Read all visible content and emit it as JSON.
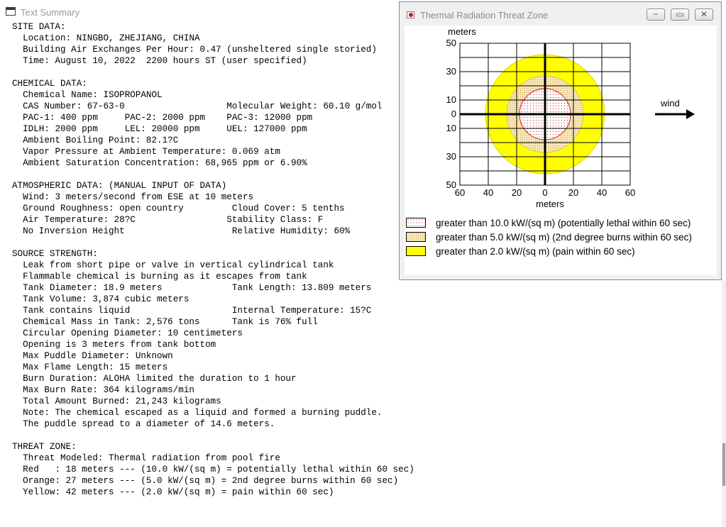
{
  "text_summary": {
    "title": "Text Summary",
    "lines": [
      "SITE DATA:",
      "  Location: NINGBO, ZHEJIANG, CHINA",
      "  Building Air Exchanges Per Hour: 0.47 (unsheltered single storied)",
      "  Time: August 10, 2022  2200 hours ST (user specified)",
      "",
      "CHEMICAL DATA:",
      "  Chemical Name: ISOPROPANOL",
      "  CAS Number: 67-63-0                   Molecular Weight: 60.10 g/mol",
      "  PAC-1: 400 ppm     PAC-2: 2000 ppm    PAC-3: 12000 ppm",
      "  IDLH: 2000 ppm     LEL: 20000 ppm     UEL: 127000 ppm",
      "  Ambient Boiling Point: 82.1?C",
      "  Vapor Pressure at Ambient Temperature: 0.069 atm",
      "  Ambient Saturation Concentration: 68,965 ppm or 6.90%",
      "",
      "ATMOSPHERIC DATA: (MANUAL INPUT OF DATA)",
      "  Wind: 3 meters/second from ESE at 10 meters",
      "  Ground Roughness: open country         Cloud Cover: 5 tenths",
      "  Air Temperature: 28?C                 Stability Class: F",
      "  No Inversion Height                    Relative Humidity: 60%",
      "",
      "SOURCE STRENGTH:",
      "  Leak from short pipe or valve in vertical cylindrical tank",
      "  Flammable chemical is burning as it escapes from tank",
      "  Tank Diameter: 18.9 meters             Tank Length: 13.809 meters",
      "  Tank Volume: 3,874 cubic meters",
      "  Tank contains liquid                   Internal Temperature: 15?C",
      "  Chemical Mass in Tank: 2,576 tons      Tank is 76% full",
      "  Circular Opening Diameter: 10 centimeters",
      "  Opening is 3 meters from tank bottom",
      "  Max Puddle Diameter: Unknown",
      "  Max Flame Length: 15 meters",
      "  Burn Duration: ALOHA limited the duration to 1 hour",
      "  Max Burn Rate: 364 kilograms/min",
      "  Total Amount Burned: 21,243 kilograms",
      "  Note: The chemical escaped as a liquid and formed a burning puddle.",
      "  The puddle spread to a diameter of 14.6 meters.",
      "",
      "THREAT ZONE:",
      "  Threat Modeled: Thermal radiation from pool fire",
      "  Red   : 18 meters --- (10.0 kW/(sq m) = potentially lethal within 60 sec)",
      "  Orange: 27 meters --- (5.0 kW/(sq m) = 2nd degree burns within 60 sec)",
      "  Yellow: 42 meters --- (2.0 kW/(sq m) = pain within 60 sec)"
    ]
  },
  "threat_window": {
    "title": "Thermal Radiation Threat Zone",
    "buttons": {
      "minimize": "−",
      "maximize": "▭",
      "close": "✕"
    },
    "axis_unit_top": "meters",
    "axis_unit_bottom": "meters",
    "wind_label": "wind",
    "y_ticks": [
      "50",
      "30",
      "10",
      "0",
      "10",
      "30",
      "50"
    ],
    "x_ticks": [
      "60",
      "40",
      "20",
      "0",
      "20",
      "40",
      "60"
    ],
    "zones": [
      {
        "name": "Red",
        "radius_m": 18,
        "fill": "#ffffff",
        "stroke": "#d01818",
        "dot_color": "#d01818",
        "legend": "greater than 10.0 kW/(sq m) (potentially lethal within 60 sec)"
      },
      {
        "name": "Orange",
        "radius_m": 27,
        "fill": "#f8e8b8",
        "stroke": "#d8c070",
        "dot_color": "#c8a050",
        "legend": "greater than 5.0 kW/(sq m) (2nd degree burns within 60 sec)"
      },
      {
        "name": "Yellow",
        "radius_m": 42,
        "fill": "#ffff00",
        "stroke": "#d8d800",
        "dot_color": "",
        "legend": "greater than 2.0 kW/(sq m) (pain within 60 sec)"
      }
    ]
  }
}
